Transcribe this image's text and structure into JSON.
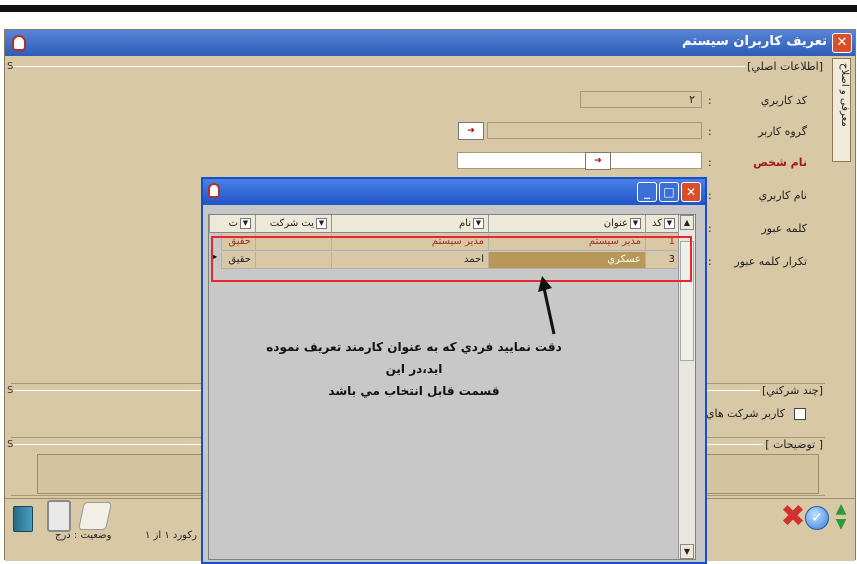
{
  "main_window": {
    "title": "تعريف كاربران سيستم",
    "side_tab": "معرفی و اصلاح",
    "sections": {
      "basic": "[اطلاعات اصلي]",
      "multi_company": "[چند شركتي]",
      "notes": "[ توضيحات ]",
      "s_marker": "S"
    },
    "fields": {
      "user_code": {
        "label": "كد كاربري",
        "value": "٢"
      },
      "user_group": {
        "label": "گروه كاربر",
        "value": ""
      },
      "person_name": {
        "label": "نام شخص",
        "value": ""
      },
      "username": {
        "label": "نام كاربري",
        "value": ""
      },
      "password": {
        "label": "كلمه عبور",
        "value": ""
      },
      "password_repeat": {
        "label": "تكرار كلمه عبور",
        "value": ""
      }
    },
    "colon": ":",
    "multi_company_checkbox": "كاربر شركت هاي",
    "status": {
      "record": "ركورد ١ از ١",
      "state": "وضعيت : درج"
    }
  },
  "popup": {
    "columns": [
      "كد",
      "عنوان",
      "نام",
      "يت شركت",
      "ت"
    ],
    "rows": [
      {
        "code": "1",
        "title": "مدير سيستم",
        "name": "مدير سيستم",
        "type": "حقيق"
      },
      {
        "code": "3",
        "title": "عسكري",
        "name": "احمد",
        "type": "حقيق"
      }
    ],
    "caret": "▼"
  },
  "annotation": {
    "line1": "دقت نماييد فردي كه به عنوان كارمند تعريف نموده ايد،در اين",
    "line2": "قسمت قابل انتخاب مي باشد"
  },
  "colors": {
    "window_bg": "#d8c8a5",
    "title_bar": "#2c5db8",
    "highlight": "#e8282d"
  },
  "icons": [
    "app-icon",
    "close-icon",
    "minimize-icon",
    "maximize-icon",
    "lookup-icon",
    "book-icon",
    "clipboard-icon",
    "scroll-icon",
    "cancel-icon",
    "confirm-icon",
    "navigate-arrows-icon"
  ]
}
